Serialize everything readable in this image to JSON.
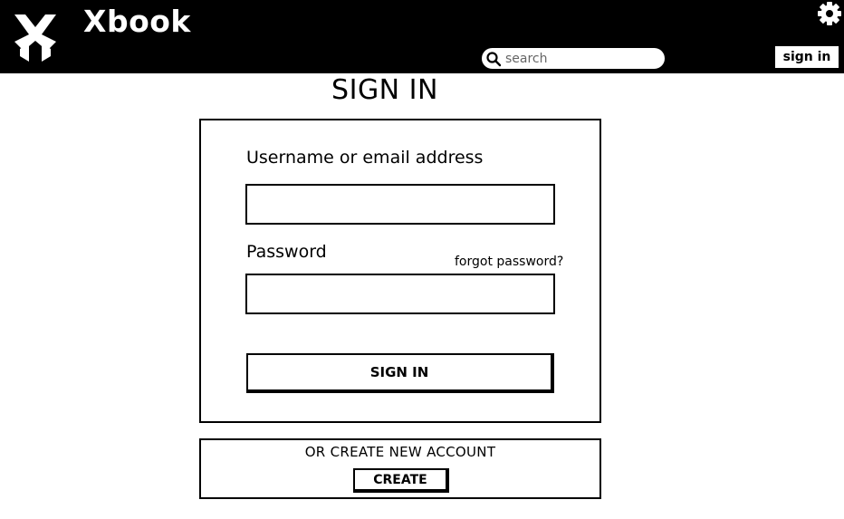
{
  "header": {
    "app_title": "Xbook",
    "logo_icon": "xbook-logo-icon",
    "settings_icon": "gear-icon",
    "search": {
      "icon": "search-icon",
      "placeholder": "search",
      "value": ""
    },
    "signin_label": "sign in"
  },
  "page": {
    "title": "SIGN IN"
  },
  "signin_form": {
    "username_label": "Username or email address",
    "username_value": "",
    "password_label": "Password",
    "password_value": "",
    "forgot_label": "forgot password?",
    "submit_label": "SIGN IN"
  },
  "create_account": {
    "prompt": "OR CREATE NEW ACCOUNT",
    "button_label": "CREATE"
  },
  "colors": {
    "header_bg": "#000000",
    "page_bg": "#ffffff",
    "ink": "#000000"
  }
}
